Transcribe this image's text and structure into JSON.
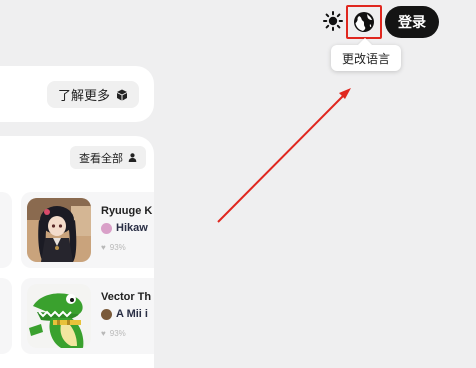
{
  "header": {
    "theme_icon": "sun-icon",
    "language_icon": "globe-icon",
    "login_label": "登录",
    "language_tooltip": "更改语言"
  },
  "promo": {
    "learn_more_label": "了解更多",
    "learn_more_icon": "cube-icon"
  },
  "section": {
    "view_all_label": "查看全部",
    "view_all_icon": "user-icon"
  },
  "cards": [
    {
      "title": "Ryuuge K",
      "author": "Hikaw",
      "rating": "93%",
      "thumb": "anime-girl-thumbnail"
    },
    {
      "title": "Vector Th",
      "author": "A Mii i",
      "rating": "93%",
      "thumb": "green-crocodile-thumbnail"
    }
  ],
  "colors": {
    "highlight": "#e0271f",
    "login_bg": "#141414",
    "page_bg": "#efeff0"
  }
}
